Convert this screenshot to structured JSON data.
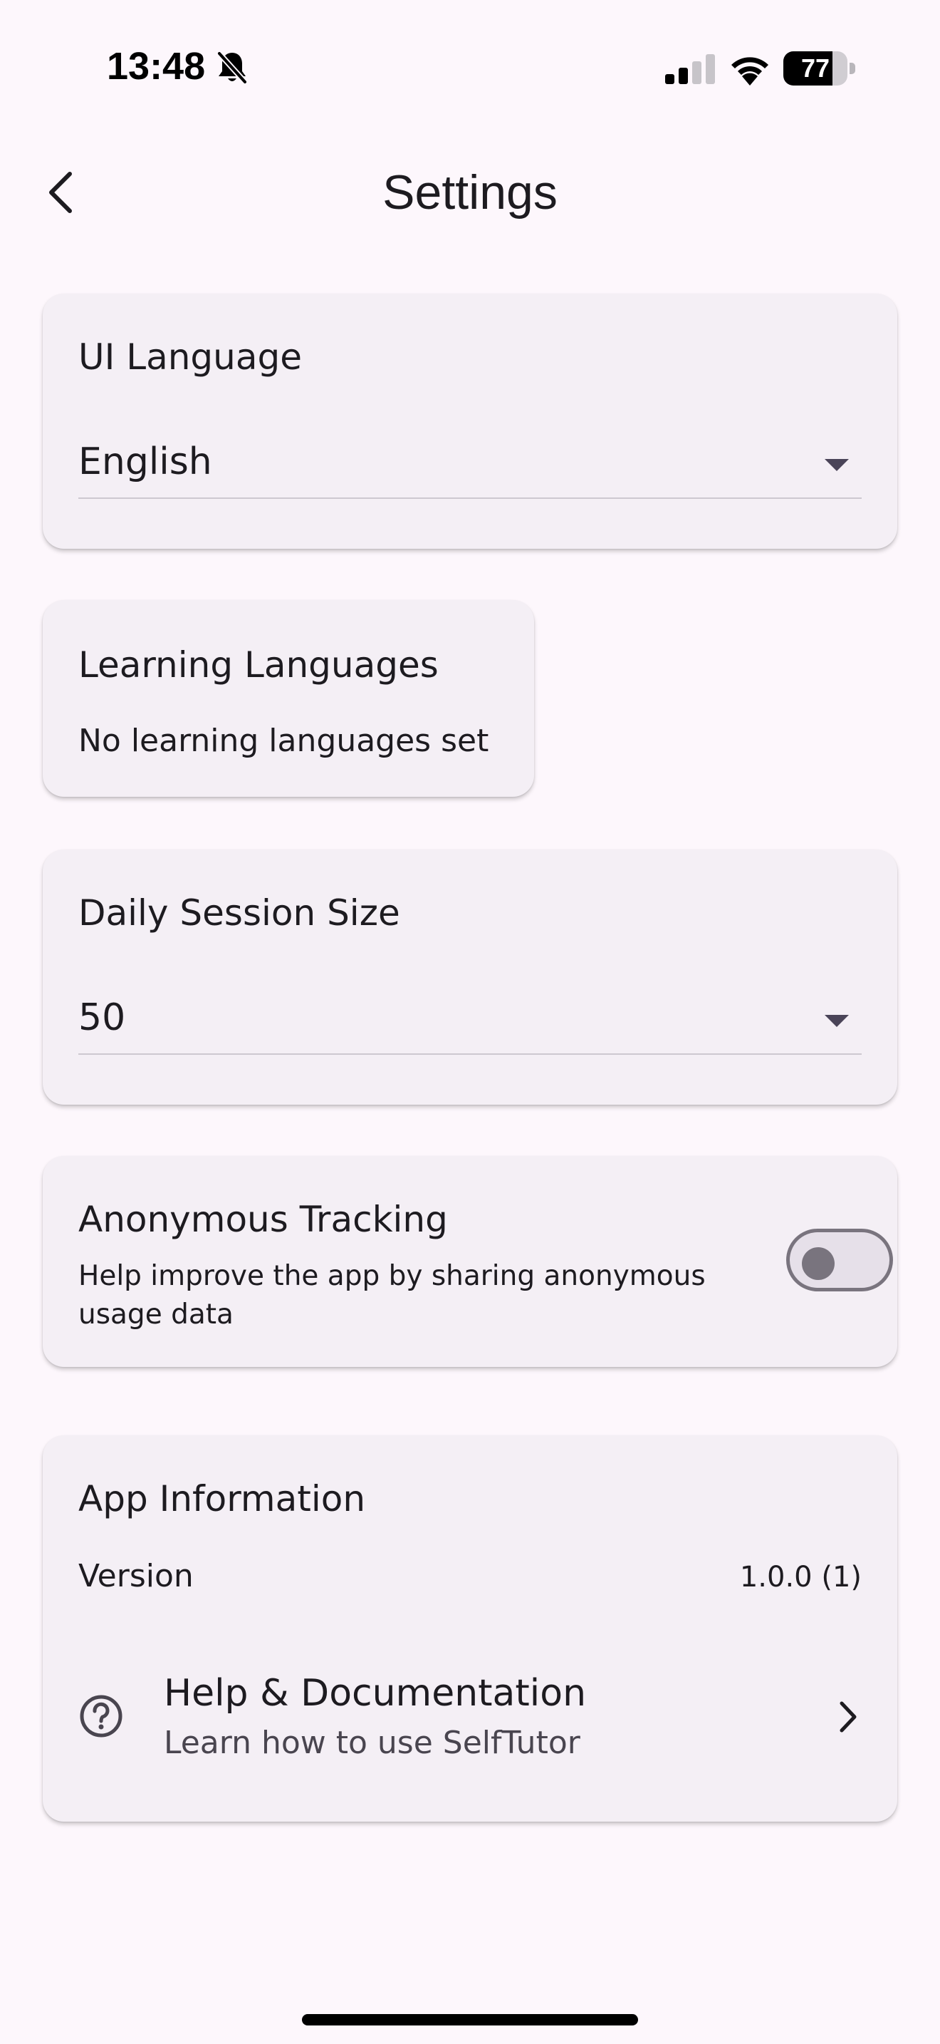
{
  "status_bar": {
    "time": "13:48",
    "battery_level": "77",
    "battery_fraction": 0.77
  },
  "app_bar": {
    "title": "Settings"
  },
  "ui_language": {
    "title": "UI Language",
    "selected": "English"
  },
  "learning_languages": {
    "title": "Learning Languages",
    "empty_text": "No learning languages set"
  },
  "daily_session": {
    "title": "Daily Session Size",
    "selected": "50"
  },
  "tracking": {
    "title": "Anonymous Tracking",
    "description_line1": "Help improve the app by sharing anonymous",
    "description_line2": "usage data",
    "enabled": false
  },
  "app_info": {
    "title": "App Information",
    "version_label": "Version",
    "version_value": "1.0.0 (1)",
    "help_title": "Help & Documentation",
    "help_subtitle": "Learn how to use SelfTutor"
  },
  "colors": {
    "background": "#fdf7fc",
    "card": "#f4eff5",
    "switch_outline": "#79747e"
  },
  "icons": [
    "bell-slash-icon",
    "cellular-signal-icon",
    "wifi-icon",
    "battery-icon",
    "chevron-left-icon",
    "chevron-down-icon",
    "help-circle-icon",
    "chevron-right-icon"
  ]
}
